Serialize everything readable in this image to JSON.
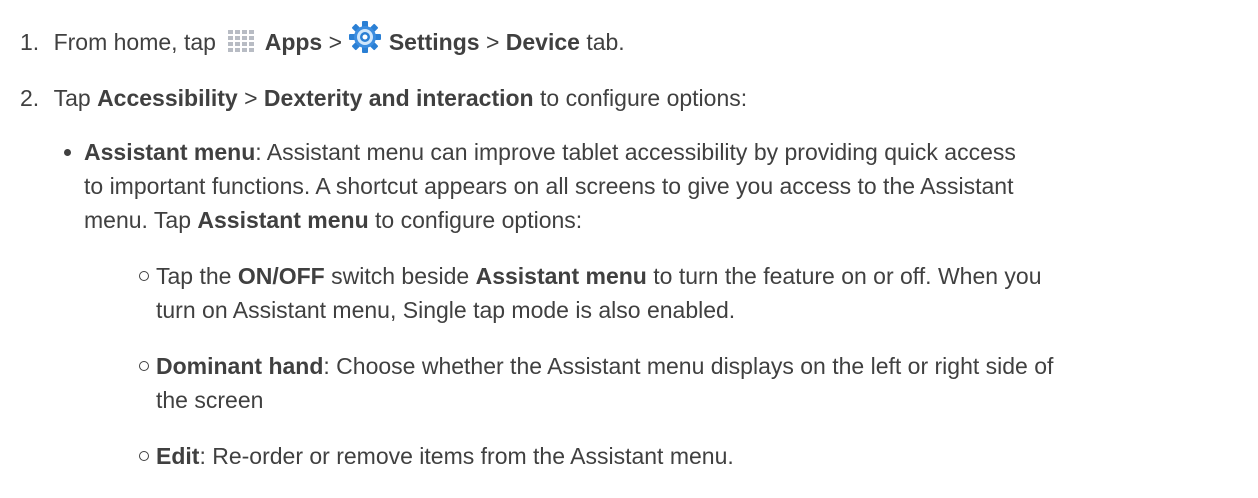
{
  "steps": [
    {
      "number": "1.",
      "t1": "From home, tap",
      "apps": "Apps",
      "sep1": ">",
      "settings": "Settings",
      "sep2": ">",
      "device": "Device",
      "t2": "tab."
    },
    {
      "number": "2.",
      "t1": "Tap",
      "accessibility": "Accessibility",
      "sep": ">",
      "dexterity": "Dexterity and interaction",
      "t2": "to configure options:"
    }
  ],
  "assistant": {
    "title": "Assistant menu",
    "line1": ": Assistant menu can improve tablet accessibility by providing quick access",
    "line2": "to important functions. A shortcut appears on all screens to give you access to the Assistant",
    "line3a": "menu. Tap",
    "line3b": "Assistant menu",
    "line3c": "to configure options:"
  },
  "subitems": [
    {
      "a": "Tap the",
      "onoff": "ON/OFF",
      "b": "switch beside",
      "menu": "Assistant menu",
      "c": "to turn the feature on or off. When you",
      "line2": "turn on Assistant menu, Single tap mode is also enabled."
    },
    {
      "title": "Dominant hand",
      "line1": ": Choose whether the Assistant menu displays on the left or right side of",
      "line2": "the screen"
    },
    {
      "title": "Edit",
      "line1": ": Re-order or remove items from the Assistant menu."
    }
  ],
  "icons": {
    "apps": "apps-grid-icon",
    "settings": "settings-gear-icon",
    "apps_color": "#b8bcc4",
    "settings_color": "#2a7fd4"
  }
}
